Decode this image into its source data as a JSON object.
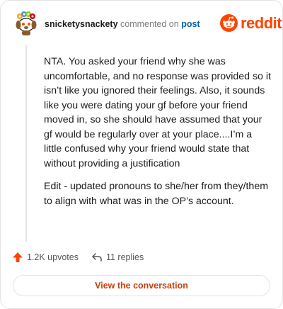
{
  "header": {
    "username": "snicketysnackety",
    "action": "commented on",
    "post_link": "post"
  },
  "logo": {
    "text": "reddit",
    "icon": "reddit-alien-icon"
  },
  "comment": {
    "paragraphs": [
      "NTA. You asked your friend why she was uncomfortable, and no response was provided so it isn’t like you ignored their feelings. Also, it sounds like you were dating your gf before your friend moved in, so she should have assumed that your gf would be regularly over at your place....I’m a little confused why your friend would state that without providing a justification",
      "Edit - updated pronouns to she/her from they/them to align with what was in the OP’s account."
    ]
  },
  "stats": {
    "upvotes": "1.2K upvotes",
    "replies": "11 replies",
    "upvote_icon": "upvote-arrow-icon",
    "reply_icon": "reply-arrow-icon"
  },
  "cta": {
    "label": "View the conversation"
  },
  "colors": {
    "brand": "#ff4500",
    "link": "#0a5fa8",
    "cta_text": "#c8400a"
  }
}
